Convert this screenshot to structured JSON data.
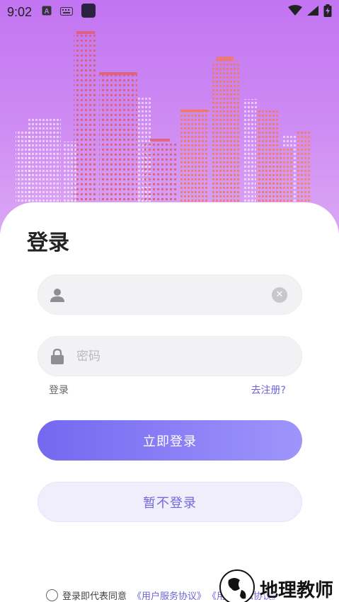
{
  "status_bar": {
    "time": "9:02",
    "icons": [
      "text-a-icon",
      "keyboard-icon",
      "app-square-icon",
      "wifi-icon",
      "signal-icon",
      "battery-charging-icon"
    ]
  },
  "login": {
    "title": "登录",
    "username": {
      "value": "",
      "placeholder": "",
      "icon": "person-icon",
      "clear_icon": "clear-icon"
    },
    "password": {
      "value": "",
      "placeholder": "密码",
      "icon": "lock-icon"
    },
    "mode_link": "登录",
    "register_link": "去注册?",
    "login_button": "立即登录",
    "skip_button": "暂不登录"
  },
  "agreement": {
    "prefix": "登录即代表同意",
    "service_link": "《用户服务协议》",
    "privacy_link": "《用户隐私协议》"
  },
  "watermark": {
    "text": "地理教师"
  },
  "colors": {
    "hero_top": "#c274f2",
    "hero_bottom": "#dba7f4",
    "accent": "#7468f0",
    "accent_light": "#9e95fb",
    "secondary_bg": "#f1eefc",
    "field_bg": "#f2f2f4"
  }
}
